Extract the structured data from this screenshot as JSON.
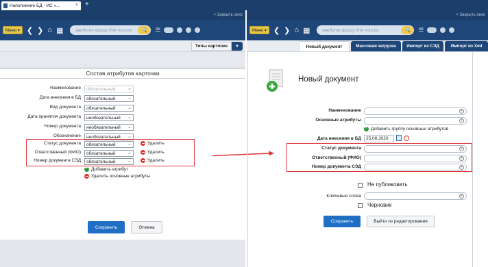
{
  "browser": {
    "tab_title": "Наполнение БД - ИС «...",
    "tab_close": "×",
    "new_tab": "+",
    "close_window": "× Закрыть окно"
  },
  "toolbar": {
    "menu_label": "Меню ▾",
    "search_placeholder": "введите фразу для поиска"
  },
  "left": {
    "types_button": "Типы карточек",
    "title": "Состав атрибутов карточки",
    "rows": [
      {
        "label": "Наименование",
        "value": "обязательный"
      },
      {
        "label": "Дата внесения в БД",
        "value": "обязательный"
      },
      {
        "label": "Вид документа",
        "value": "обязательный"
      },
      {
        "label": "Дата принятия документа",
        "value": "необязательный"
      },
      {
        "label": "Номер документа",
        "value": "необязательный"
      },
      {
        "label": "Обозначение",
        "value": "необязательный"
      },
      {
        "label": "Статус документа",
        "value": "обязательный"
      },
      {
        "label": "Ответственный (ФИО)",
        "value": "обязательный"
      },
      {
        "label": "Номер документа СЭД",
        "value": "обязательный"
      }
    ],
    "delete_label": "Удалить",
    "add_attribute": "Добавить атрибут",
    "delete_main": "Удалить основные атрибуты",
    "save_button": "Сохранить",
    "cancel_button": "Отмена"
  },
  "right": {
    "tabs": [
      "Новый документ",
      "Массовая загрузка",
      "Импорт из СЭД",
      "Импорт из Xml"
    ],
    "title": "Новый документ",
    "fields": [
      {
        "label": "Наименование"
      },
      {
        "label": "Основные атрибуты"
      }
    ],
    "add_group": "Добавить группу основных атрибутов",
    "date_label": "Дата внесения в БД",
    "date_value": "25.08.2020",
    "highlight_fields": [
      {
        "label": "Статус документа"
      },
      {
        "label": "Ответственный (ФИО)"
      },
      {
        "label": "Номер документа СЭД"
      }
    ],
    "not_publish": "Не публиковать",
    "keywords": "Ключевые слова",
    "draft": "Черновик",
    "save_button": "Сохранить",
    "exit_edit": "Выйти из редактирования"
  },
  "colors": {
    "nav_blue": "#1e4678",
    "highlight_red": "#e0343a",
    "primary_button": "#1f6fc4"
  }
}
